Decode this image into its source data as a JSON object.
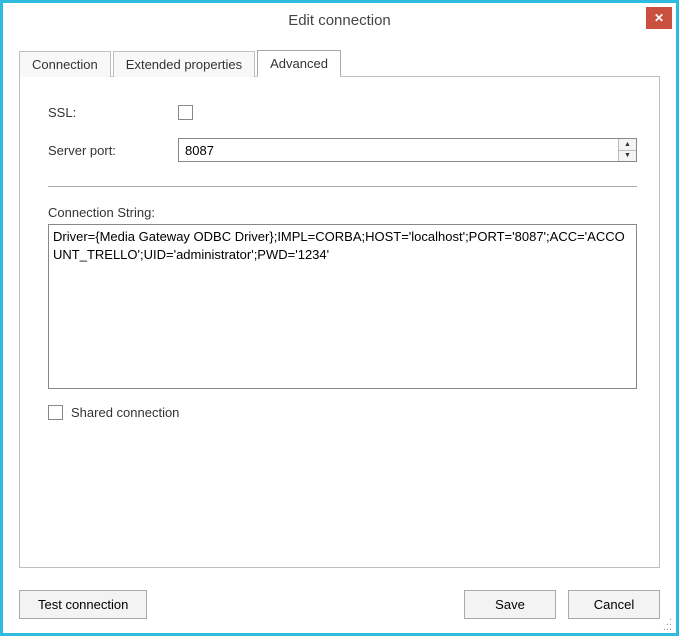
{
  "window": {
    "title": "Edit connection"
  },
  "tabs": {
    "connection": "Connection",
    "extended": "Extended properties",
    "advanced": "Advanced",
    "active": "advanced"
  },
  "advanced": {
    "ssl_label": "SSL:",
    "ssl_checked": false,
    "server_port_label": "Server port:",
    "server_port_value": "8087",
    "connection_string_label": "Connection String:",
    "connection_string_value": "Driver={Media Gateway ODBC Driver};IMPL=CORBA;HOST='localhost';PORT='8087';ACC='ACCOUNT_TRELLO';UID='administrator';PWD='1234'",
    "shared_label": "Shared connection",
    "shared_checked": false
  },
  "buttons": {
    "test": "Test connection",
    "save": "Save",
    "cancel": "Cancel"
  }
}
